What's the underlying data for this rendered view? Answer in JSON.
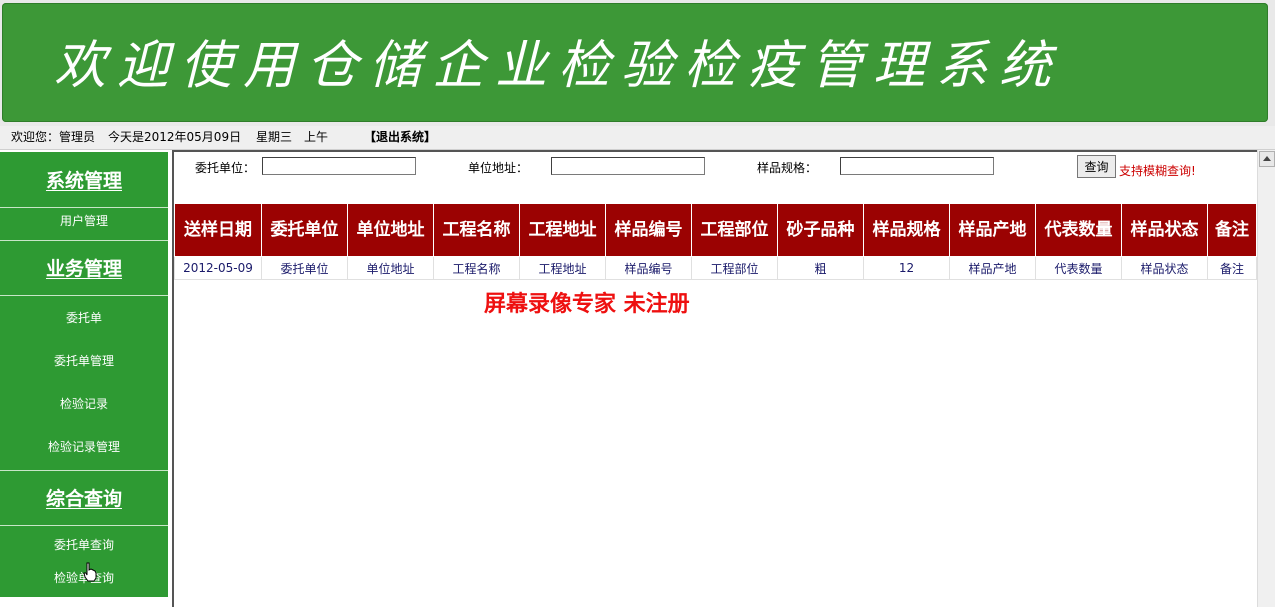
{
  "banner": {
    "title": "欢迎使用仓储企业检验检疫管理系统"
  },
  "status": {
    "welcome": "欢迎您：管理员",
    "date": "今天是2012年05月09日",
    "weekday": "星期三",
    "period": "上午",
    "logout": "【退出系统】"
  },
  "sidebar": {
    "sections": [
      {
        "title": "系统管理",
        "items": [
          "用户管理"
        ]
      },
      {
        "title": "业务管理",
        "items": [
          "委托单",
          "委托单管理",
          "检验记录",
          "检验记录管理"
        ]
      },
      {
        "title": "综合查询",
        "items": [
          "委托单查询",
          "检验单查询"
        ]
      }
    ]
  },
  "search": {
    "client_label": "委托单位：",
    "client_value": "",
    "address_label": "单位地址：",
    "address_value": "",
    "spec_label": "样品规格：",
    "spec_value": "",
    "button": "查询",
    "tip": "支持模糊查询!"
  },
  "table": {
    "headers": [
      "送样日期",
      "委托单位",
      "单位地址",
      "工程名称",
      "工程地址",
      "样品编号",
      "工程部位",
      "砂子品种",
      "样品规格",
      "样品产地",
      "代表数量",
      "样品状态",
      "备注"
    ],
    "rows": [
      [
        "2012-05-09",
        "委托单位",
        "单位地址",
        "工程名称",
        "工程地址",
        "样品编号",
        "工程部位",
        "粗",
        "12",
        "样品产地",
        "代表数量",
        "样品状态",
        "备注"
      ]
    ]
  },
  "watermark": "屏幕录像专家  未注册",
  "colors": {
    "banner_green": "#3d9837",
    "sidebar_green": "#2e9a33",
    "header_red": "#9b0202",
    "tip_red": "#cc0000"
  }
}
